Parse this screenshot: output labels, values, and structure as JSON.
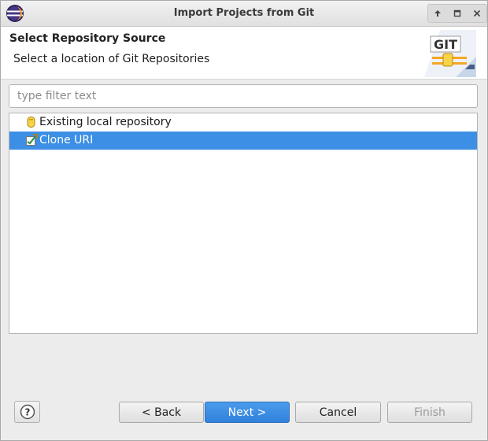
{
  "window": {
    "title": "Import Projects from Git",
    "buttons": [
      "maximize-up",
      "restore",
      "close"
    ]
  },
  "header": {
    "title": "Select Repository Source",
    "description": "Select a location of Git Repositories",
    "logo_text": "GIT"
  },
  "filter": {
    "placeholder": "type filter text",
    "value": ""
  },
  "sources": [
    {
      "label": "Existing local repository",
      "icon": "repository-icon",
      "selected": false
    },
    {
      "label": "Clone URI",
      "icon": "clone-uri-icon",
      "selected": true
    }
  ],
  "footer": {
    "help_label": "?",
    "back_label": "< Back",
    "next_label": "Next >",
    "cancel_label": "Cancel",
    "finish_label": "Finish",
    "finish_enabled": false
  },
  "colors": {
    "selection": "#3c8fe4",
    "primary_button": "#3c8fe4"
  }
}
